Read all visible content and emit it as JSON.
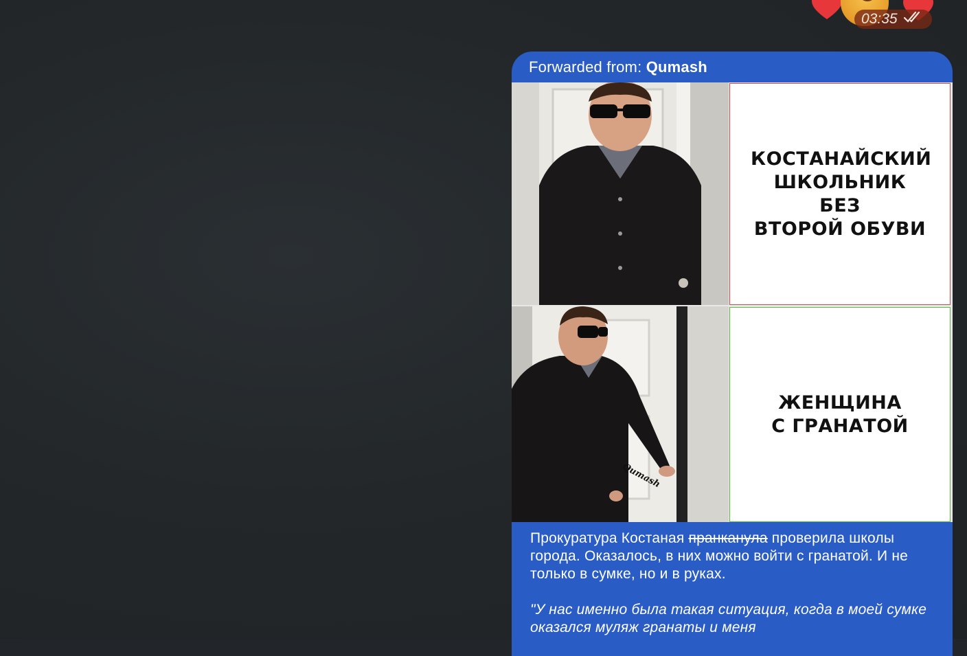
{
  "previous_message": {
    "time": "03:35",
    "read_status_icon": "double-check-icon",
    "reactions": [
      "red-heart-icon",
      "laughing-face-emoji",
      "red-heart-icon"
    ]
  },
  "message": {
    "forwarded_label": "Forwarded from:",
    "forwarded_name": "Qumash",
    "meme": {
      "top_text_lines": [
        "КОСТАНАЙСКИЙ",
        "ШКОЛЬНИК БЕЗ",
        "ВТОРОЙ ОБУВИ"
      ],
      "bottom_text_lines": [
        "ЖЕНЩИНА",
        "С ГРАНАТОЙ"
      ],
      "watermark": "Qumash"
    },
    "caption": {
      "part1": "Прокуратура Костаная ",
      "struck": "пранканула",
      "part2": " проверила школы города. Оказалось, в них можно войти с гранатой. И не только в сумке, но и в руках.",
      "quote": "\"У нас именно была такая ситуация, когда в моей сумке оказался муляж гранаты и меня"
    }
  },
  "colors": {
    "chat_background": "#22262a",
    "bubble": "#2a5cc5",
    "time_badge": "#78281a",
    "panel_top_border": "#d44a4a",
    "panel_bottom_border": "#56c23c"
  }
}
